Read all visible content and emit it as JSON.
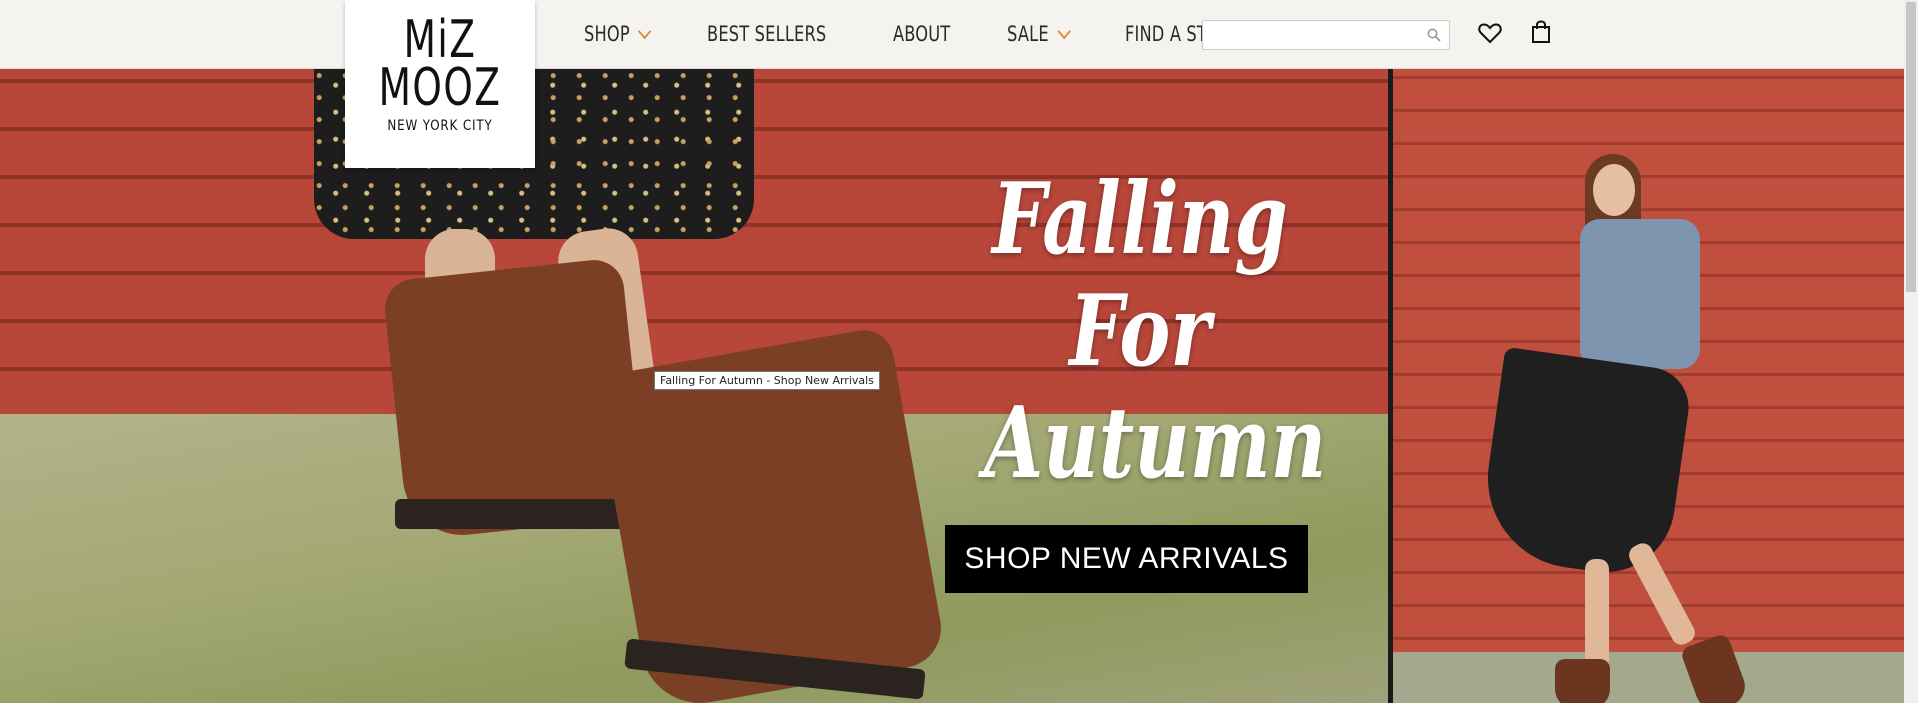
{
  "brand": {
    "logo_line1": "MiZ",
    "logo_line2": "MOOZ",
    "logo_line3": "NEW YORK CITY"
  },
  "nav": {
    "items": [
      {
        "label": "SHOP",
        "has_dropdown": true
      },
      {
        "label": "BEST SELLERS",
        "has_dropdown": false
      },
      {
        "label": "ABOUT",
        "has_dropdown": false
      },
      {
        "label": "SALE",
        "has_dropdown": true
      },
      {
        "label": "FIND A STORE",
        "has_dropdown": false
      }
    ],
    "accent_color": "#e08a2c"
  },
  "search": {
    "value": "",
    "placeholder": "",
    "icon": "search-icon"
  },
  "header_icons": {
    "wishlist": "heart-icon",
    "cart": "shopping-bag-icon"
  },
  "hero": {
    "headline_line1": "Falling",
    "headline_line2": "For",
    "headline_line3": "Autumn",
    "cta_label": "SHOP NEW ARRIVALS",
    "tooltip": "Falling For Autumn - Shop New Arrivals"
  }
}
